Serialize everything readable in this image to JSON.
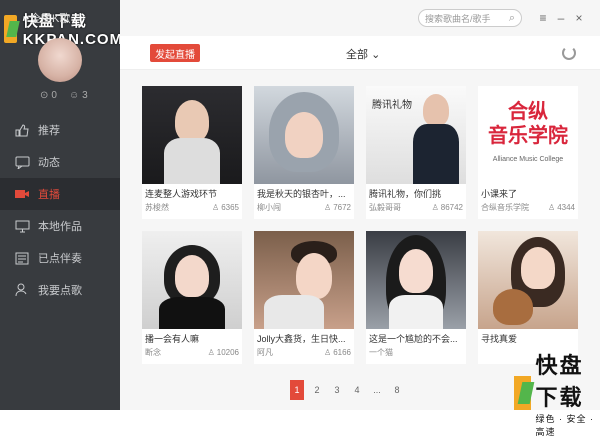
{
  "watermark": {
    "top": "快盘下载 KKPAN.COM",
    "bottom_big": "盘下载",
    "bottom_logo_char": "快",
    "bottom_small": "绿色 · 安全 · 高速"
  },
  "app": {
    "name": "全民K歌"
  },
  "profile": {
    "stat1": "0",
    "stat2": "3"
  },
  "search": {
    "placeholder": "搜索歌曲名/歌手"
  },
  "window": {
    "menu": "≡",
    "minimize": "–",
    "close": "×"
  },
  "sidebar": {
    "items": [
      {
        "label": "推荐",
        "icon": "thumbs-up-icon"
      },
      {
        "label": "动态",
        "icon": "chat-icon"
      },
      {
        "label": "直播",
        "icon": "video-icon"
      },
      {
        "label": "本地作品",
        "icon": "monitor-icon"
      },
      {
        "label": "已点伴奏",
        "icon": "list-icon"
      },
      {
        "label": "我要点歌",
        "icon": "person-icon"
      }
    ]
  },
  "toolbar": {
    "live_button": "发起直播",
    "filter": "全部"
  },
  "cards": [
    {
      "title": "连麦整人游戏环节",
      "user": "苏梭然",
      "count": "6365"
    },
    {
      "title": "我是秋天的银杏叶，...",
      "user": "柳小闯",
      "count": "7672"
    },
    {
      "title": "腾讯礼物，你们挑",
      "user": "弘毅哥哥",
      "count": "86742"
    },
    {
      "title": "小课来了",
      "user": "合纵音乐学院",
      "count": "4344"
    },
    {
      "title": "播一会有人嘛",
      "user": "断念",
      "count": "10206"
    },
    {
      "title": "Jolly大鑫货，生日快...",
      "user": "阿凡",
      "count": "6166"
    },
    {
      "title": "这是一个尴尬的不会...",
      "user": "一个猫",
      "count": ""
    },
    {
      "title": "寻找真爱",
      "user": "",
      "count": ""
    }
  ],
  "thumb_text": {
    "c3": "腾讯礼物",
    "c4_big": "合纵\n音乐学院",
    "c4_small": "Alliance Music College"
  },
  "pagination": {
    "pages": [
      "1",
      "2",
      "3",
      "4",
      "...",
      "8"
    ],
    "active": "1"
  }
}
